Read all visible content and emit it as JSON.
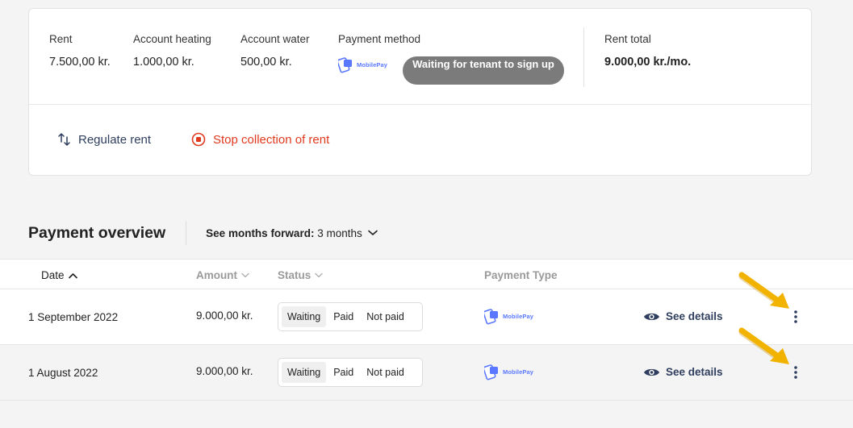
{
  "rent_card": {
    "columns": [
      {
        "label": "Rent",
        "value": "7.500,00 kr."
      },
      {
        "label": "Account heating",
        "value": "1.000,00 kr."
      },
      {
        "label": "Account water",
        "value": "500,00 kr."
      }
    ],
    "payment_method": {
      "label": "Payment method",
      "logo_text": "MobilePay",
      "status": "Waiting for tenant to sign up"
    },
    "total": {
      "label": "Rent total",
      "value": "9.000,00 kr./mo."
    },
    "actions": {
      "regulate": "Regulate rent",
      "stop": "Stop collection of rent"
    }
  },
  "overview": {
    "title": "Payment overview",
    "months_label": "See months forward:",
    "months_value": "3 months"
  },
  "table": {
    "headers": {
      "date": "Date",
      "amount": "Amount",
      "status": "Status",
      "payment_type": "Payment Type"
    },
    "rows": [
      {
        "date": "1 September 2022",
        "amount": "9.000,00 kr.",
        "status_options": [
          "Waiting",
          "Paid",
          "Not paid"
        ],
        "selected_status": "Waiting",
        "payment_logo": "MobilePay",
        "details_label": "See details"
      },
      {
        "date": "1 August 2022",
        "amount": "9.000,00 kr.",
        "status_options": [
          "Waiting",
          "Paid",
          "Not paid"
        ],
        "selected_status": "Waiting",
        "payment_logo": "MobilePay",
        "details_label": "See details"
      }
    ]
  },
  "colors": {
    "accent_navy": "#2f3e5e",
    "danger": "#e0391d",
    "mobilepay_blue": "#5a78ff",
    "pill_gray": "#7b7b7b",
    "annotation_arrow": "#f2b300"
  },
  "icons": {
    "regulate": "arrows-up-down-icon",
    "stop": "stop-circle-icon",
    "sort": "chevron-up-icon",
    "months": "chevron-down-icon",
    "details": "eye-icon",
    "more": "kebab-menu-icon"
  }
}
